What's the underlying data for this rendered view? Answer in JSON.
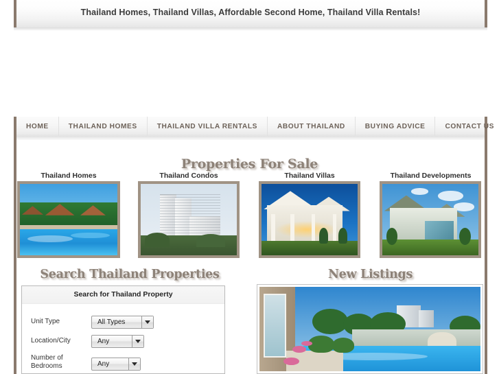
{
  "banner": {
    "title": "Thailand Homes, Thailand Villas, Affordable Second Home, Thailand Villa Rentals!"
  },
  "nav": {
    "items": [
      {
        "label": "HOME"
      },
      {
        "label": "THAILAND HOMES"
      },
      {
        "label": "THAILAND VILLA RENTALS"
      },
      {
        "label": "ABOUT THAILAND"
      },
      {
        "label": "BUYING ADVICE"
      },
      {
        "label": "CONTACT US"
      }
    ]
  },
  "properties_section": {
    "heading": "Properties For Sale",
    "categories": [
      {
        "label": "Thailand Homes",
        "image": "resort-pool-villas-photo"
      },
      {
        "label": "Thailand Condos",
        "image": "condo-tower-photo"
      },
      {
        "label": "Thailand Villas",
        "image": "white-villa-dusk-photo"
      },
      {
        "label": "Thailand Developments",
        "image": "green-house-development-photo"
      }
    ]
  },
  "search_section": {
    "heading": "Search Thailand Properties",
    "panel_title": "Search for Thailand Property",
    "fields": [
      {
        "label": "Unit Type",
        "value": "All Types"
      },
      {
        "label": "Location/City",
        "value": "Any"
      },
      {
        "label": "Number of Bedrooms",
        "value": "Any"
      }
    ]
  },
  "new_listings_section": {
    "heading": "New Listings",
    "image": "poolside-house-elephant-mural-photo"
  },
  "colors": {
    "frame_border": "#8a7a6d",
    "heading_text": "#8d8278",
    "nav_text": "#6d6259",
    "banner_text": "#3a3a3a",
    "thumb_border": "#a09384"
  }
}
